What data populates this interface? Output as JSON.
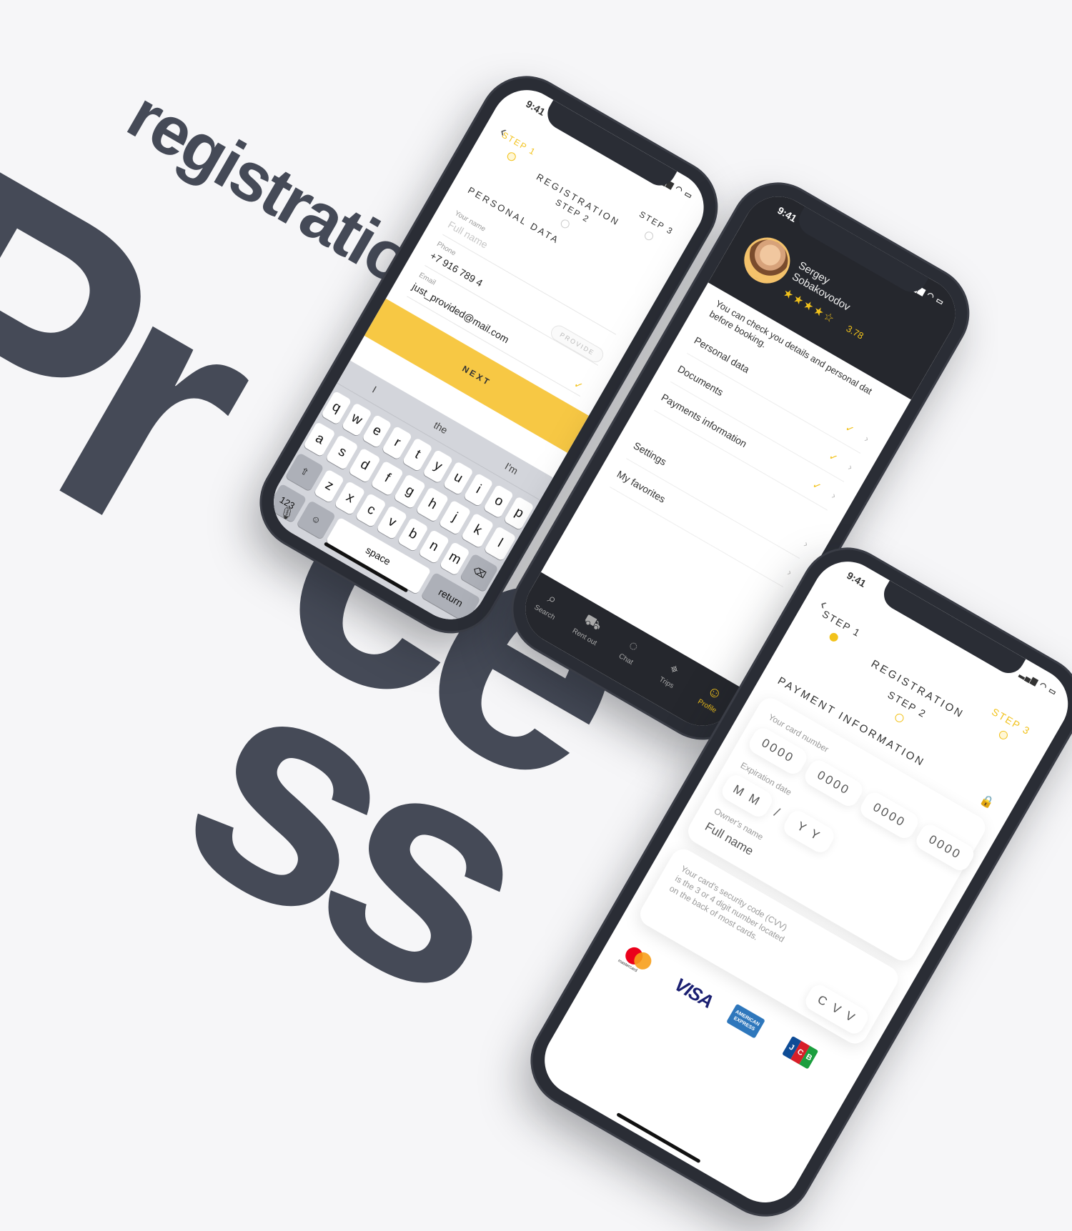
{
  "backdrop": {
    "word_registration": "registration",
    "word_pr": "Pr",
    "word_ce": "ce",
    "word_ss": "ss"
  },
  "colors": {
    "accent": "#f2c21b",
    "dark": "#25272d",
    "backdrop_text": "#454a57",
    "secure": "#8bc34a"
  },
  "status": {
    "time": "9:41"
  },
  "registration": {
    "title": "Registration",
    "steps": [
      "Step 1",
      "Step 2",
      "Step 3"
    ]
  },
  "personal": {
    "section": "Personal data",
    "name_label": "Your name",
    "name_placeholder": "Full name",
    "phone_label": "Phone",
    "phone_value": "+7 916 789 4",
    "email_label": "Email",
    "email_value": "just_provided@mail.com",
    "provide_label": "Provide",
    "next_label": "Next",
    "suggestions": [
      "I",
      "the",
      "I'm"
    ],
    "keys_row1": [
      "q",
      "w",
      "e",
      "r",
      "t",
      "y",
      "u",
      "i",
      "o",
      "p"
    ],
    "keys_row2": [
      "a",
      "s",
      "d",
      "f",
      "g",
      "h",
      "j",
      "k",
      "l"
    ],
    "keys_row3": [
      "z",
      "x",
      "c",
      "v",
      "b",
      "n",
      "m"
    ],
    "key_123": "123",
    "key_space": "space",
    "key_return": "return"
  },
  "profile": {
    "first_name": "Sergey",
    "last_name": "Sobakovodov",
    "stars": "★★★★☆",
    "rating": "3.78",
    "description": "You can check you details and personal dat before booking.",
    "menu": [
      "Personal data",
      "Documents",
      "Payments information",
      "Settings",
      "My favorites"
    ],
    "tabs": [
      "Search",
      "Rent out",
      "Chat",
      "Trips",
      "Profile"
    ]
  },
  "payment": {
    "section": "Payment information",
    "card_number_label": "Your card number",
    "card_groups": [
      "0000",
      "0000",
      "0000",
      "0000"
    ],
    "expiration_label": "Expiration date",
    "month_ph": "M M",
    "separator": "/",
    "year_ph": "Y Y",
    "owner_label": "Owner's name",
    "owner_ph": "Full name",
    "cvv_info_1": "Your card's security code (CVV)",
    "cvv_info_2": "is the 3 or 4 digit number located",
    "cvv_info_3": "on the back of most cards.",
    "cvv_ph": "C V V",
    "brands": {
      "mastercard": "mastercard",
      "visa": "VISA",
      "amex_1": "AMERICAN",
      "amex_2": "EXPRESS",
      "jcb": [
        "J",
        "C",
        "B"
      ]
    }
  }
}
